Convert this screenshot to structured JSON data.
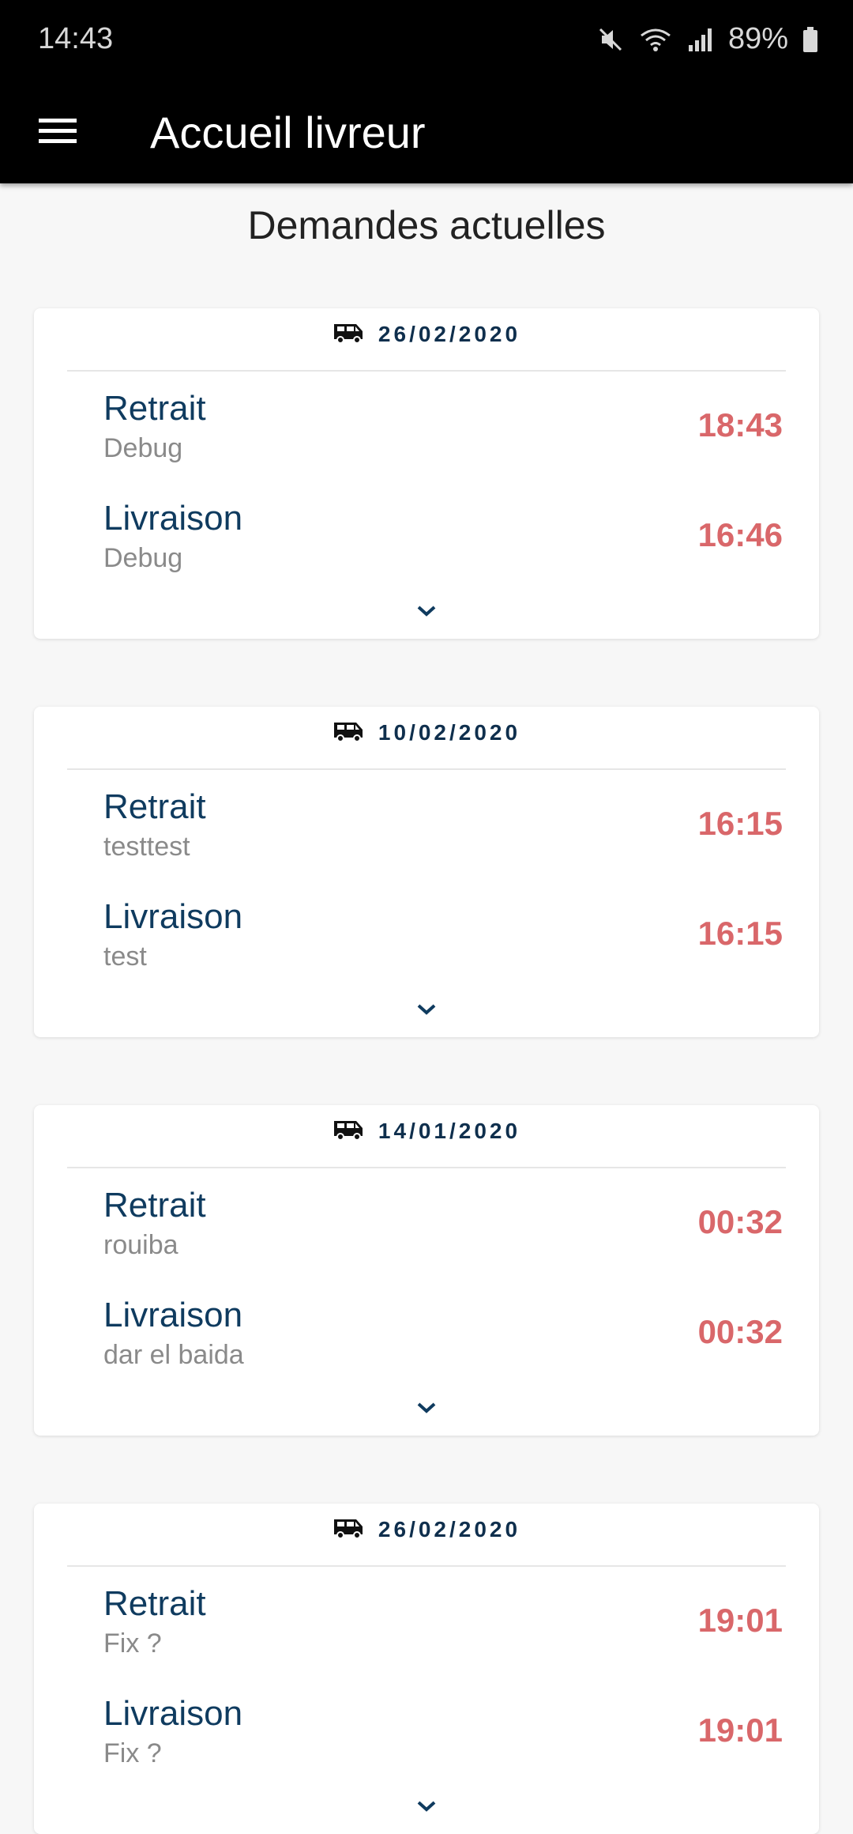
{
  "status_bar": {
    "time": "14:43",
    "battery": "89%"
  },
  "app_bar": {
    "title": "Accueil livreur",
    "menu_icon": "hamburger-menu-icon"
  },
  "main": {
    "section_title": "Demandes actuelles",
    "cards": [
      {
        "date": "26/02/2020",
        "pickup": {
          "label": "Retrait",
          "place": "Debug",
          "time": "18:43"
        },
        "delivery": {
          "label": "Livraison",
          "place": "Debug",
          "time": "16:46"
        }
      },
      {
        "date": "10/02/2020",
        "pickup": {
          "label": "Retrait",
          "place": "testtest",
          "time": "16:15"
        },
        "delivery": {
          "label": "Livraison",
          "place": "test",
          "time": "16:15"
        }
      },
      {
        "date": "14/01/2020",
        "pickup": {
          "label": "Retrait",
          "place": "rouiba",
          "time": "00:32"
        },
        "delivery": {
          "label": "Livraison",
          "place": "dar el baida",
          "time": "00:32"
        }
      },
      {
        "date": "26/02/2020",
        "pickup": {
          "label": "Retrait",
          "place": "Fix ?",
          "time": "19:01"
        },
        "delivery": {
          "label": "Livraison",
          "place": "Fix ?",
          "time": "19:01"
        }
      }
    ]
  },
  "colors": {
    "app_bar": "#000000",
    "accent_dark": "#0f3b5f",
    "time_red": "#d9676a",
    "background": "#f7f7f7"
  }
}
